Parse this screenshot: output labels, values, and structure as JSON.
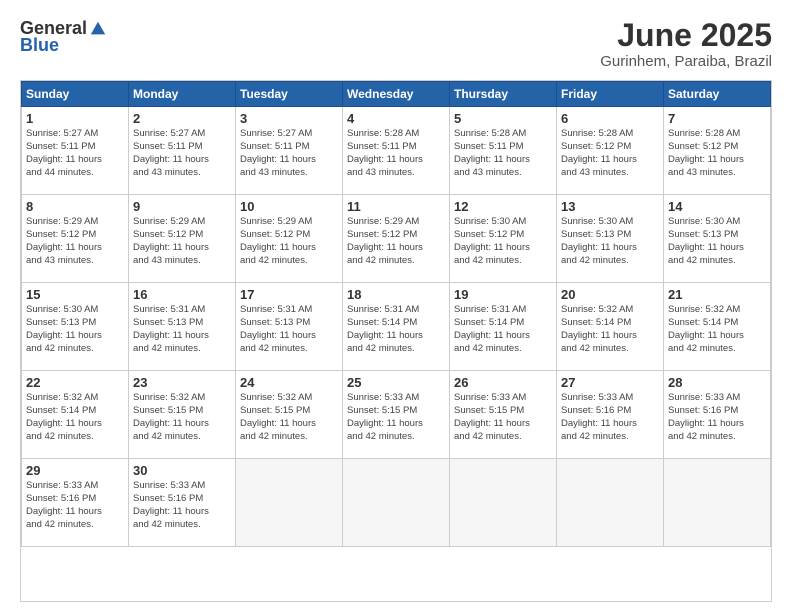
{
  "header": {
    "logo": {
      "general": "General",
      "blue": "Blue"
    },
    "title": "June 2025",
    "subtitle": "Gurinhem, Paraiba, Brazil"
  },
  "calendar": {
    "days_of_week": [
      "Sunday",
      "Monday",
      "Tuesday",
      "Wednesday",
      "Thursday",
      "Friday",
      "Saturday"
    ],
    "weeks": [
      [
        null,
        {
          "day": 2,
          "info": "Sunrise: 5:27 AM\nSunset: 5:11 PM\nDaylight: 11 hours\nand 43 minutes."
        },
        {
          "day": 3,
          "info": "Sunrise: 5:27 AM\nSunset: 5:11 PM\nDaylight: 11 hours\nand 43 minutes."
        },
        {
          "day": 4,
          "info": "Sunrise: 5:28 AM\nSunset: 5:11 PM\nDaylight: 11 hours\nand 43 minutes."
        },
        {
          "day": 5,
          "info": "Sunrise: 5:28 AM\nSunset: 5:11 PM\nDaylight: 11 hours\nand 43 minutes."
        },
        {
          "day": 6,
          "info": "Sunrise: 5:28 AM\nSunset: 5:12 PM\nDaylight: 11 hours\nand 43 minutes."
        },
        {
          "day": 7,
          "info": "Sunrise: 5:28 AM\nSunset: 5:12 PM\nDaylight: 11 hours\nand 43 minutes."
        }
      ],
      [
        {
          "day": 8,
          "info": "Sunrise: 5:29 AM\nSunset: 5:12 PM\nDaylight: 11 hours\nand 43 minutes."
        },
        {
          "day": 9,
          "info": "Sunrise: 5:29 AM\nSunset: 5:12 PM\nDaylight: 11 hours\nand 43 minutes."
        },
        {
          "day": 10,
          "info": "Sunrise: 5:29 AM\nSunset: 5:12 PM\nDaylight: 11 hours\nand 42 minutes."
        },
        {
          "day": 11,
          "info": "Sunrise: 5:29 AM\nSunset: 5:12 PM\nDaylight: 11 hours\nand 42 minutes."
        },
        {
          "day": 12,
          "info": "Sunrise: 5:30 AM\nSunset: 5:12 PM\nDaylight: 11 hours\nand 42 minutes."
        },
        {
          "day": 13,
          "info": "Sunrise: 5:30 AM\nSunset: 5:13 PM\nDaylight: 11 hours\nand 42 minutes."
        },
        {
          "day": 14,
          "info": "Sunrise: 5:30 AM\nSunset: 5:13 PM\nDaylight: 11 hours\nand 42 minutes."
        }
      ],
      [
        {
          "day": 15,
          "info": "Sunrise: 5:30 AM\nSunset: 5:13 PM\nDaylight: 11 hours\nand 42 minutes."
        },
        {
          "day": 16,
          "info": "Sunrise: 5:31 AM\nSunset: 5:13 PM\nDaylight: 11 hours\nand 42 minutes."
        },
        {
          "day": 17,
          "info": "Sunrise: 5:31 AM\nSunset: 5:13 PM\nDaylight: 11 hours\nand 42 minutes."
        },
        {
          "day": 18,
          "info": "Sunrise: 5:31 AM\nSunset: 5:14 PM\nDaylight: 11 hours\nand 42 minutes."
        },
        {
          "day": 19,
          "info": "Sunrise: 5:31 AM\nSunset: 5:14 PM\nDaylight: 11 hours\nand 42 minutes."
        },
        {
          "day": 20,
          "info": "Sunrise: 5:32 AM\nSunset: 5:14 PM\nDaylight: 11 hours\nand 42 minutes."
        },
        {
          "day": 21,
          "info": "Sunrise: 5:32 AM\nSunset: 5:14 PM\nDaylight: 11 hours\nand 42 minutes."
        }
      ],
      [
        {
          "day": 22,
          "info": "Sunrise: 5:32 AM\nSunset: 5:14 PM\nDaylight: 11 hours\nand 42 minutes."
        },
        {
          "day": 23,
          "info": "Sunrise: 5:32 AM\nSunset: 5:15 PM\nDaylight: 11 hours\nand 42 minutes."
        },
        {
          "day": 24,
          "info": "Sunrise: 5:32 AM\nSunset: 5:15 PM\nDaylight: 11 hours\nand 42 minutes."
        },
        {
          "day": 25,
          "info": "Sunrise: 5:33 AM\nSunset: 5:15 PM\nDaylight: 11 hours\nand 42 minutes."
        },
        {
          "day": 26,
          "info": "Sunrise: 5:33 AM\nSunset: 5:15 PM\nDaylight: 11 hours\nand 42 minutes."
        },
        {
          "day": 27,
          "info": "Sunrise: 5:33 AM\nSunset: 5:16 PM\nDaylight: 11 hours\nand 42 minutes."
        },
        {
          "day": 28,
          "info": "Sunrise: 5:33 AM\nSunset: 5:16 PM\nDaylight: 11 hours\nand 42 minutes."
        }
      ],
      [
        {
          "day": 29,
          "info": "Sunrise: 5:33 AM\nSunset: 5:16 PM\nDaylight: 11 hours\nand 42 minutes."
        },
        {
          "day": 30,
          "info": "Sunrise: 5:33 AM\nSunset: 5:16 PM\nDaylight: 11 hours\nand 42 minutes."
        },
        null,
        null,
        null,
        null,
        null
      ]
    ],
    "first_week_first_day": {
      "day": 1,
      "info": "Sunrise: 5:27 AM\nSunset: 5:11 PM\nDaylight: 11 hours\nand 44 minutes."
    }
  }
}
